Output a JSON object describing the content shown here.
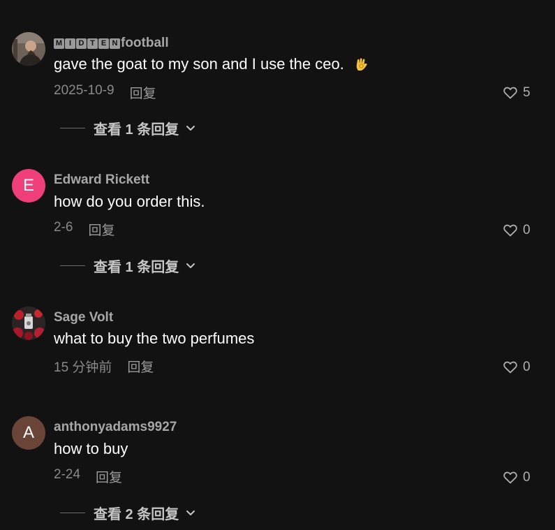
{
  "comments": [
    {
      "username_prefix_letters": [
        "M",
        "I",
        "D",
        "T",
        "E",
        "N"
      ],
      "username_suffix": "football",
      "text": "gave the goat to my son and I use the ceo.",
      "emoji": "ok-hand-emoji",
      "date": "2025-10-9",
      "reply_label": "回复",
      "likes": "5",
      "view_replies_label": "查看 1 条回复"
    },
    {
      "avatar_letter": "E",
      "avatar_color": "#ee3f7a",
      "username": "Edward Rickett",
      "text": "how do you order this.",
      "date": "2-6",
      "reply_label": "回复",
      "likes": "0",
      "view_replies_label": "查看 1 条回复"
    },
    {
      "username": "Sage Volt",
      "text": "what to buy the two perfumes",
      "date": "15 分钟前",
      "reply_label": "回复",
      "likes": "0"
    },
    {
      "avatar_letter": "A",
      "avatar_color": "#6b4438",
      "username": "anthonyadams9927",
      "text": "how to buy",
      "date": "2-24",
      "reply_label": "回复",
      "likes": "0",
      "view_replies_label": "查看 2 条回复"
    }
  ],
  "icons": {
    "like": "heart-outline-icon",
    "expand": "chevron-down-icon"
  },
  "colors": {
    "background": "#121212",
    "text_primary": "#ffffff",
    "text_secondary": "#a7a7a7"
  }
}
